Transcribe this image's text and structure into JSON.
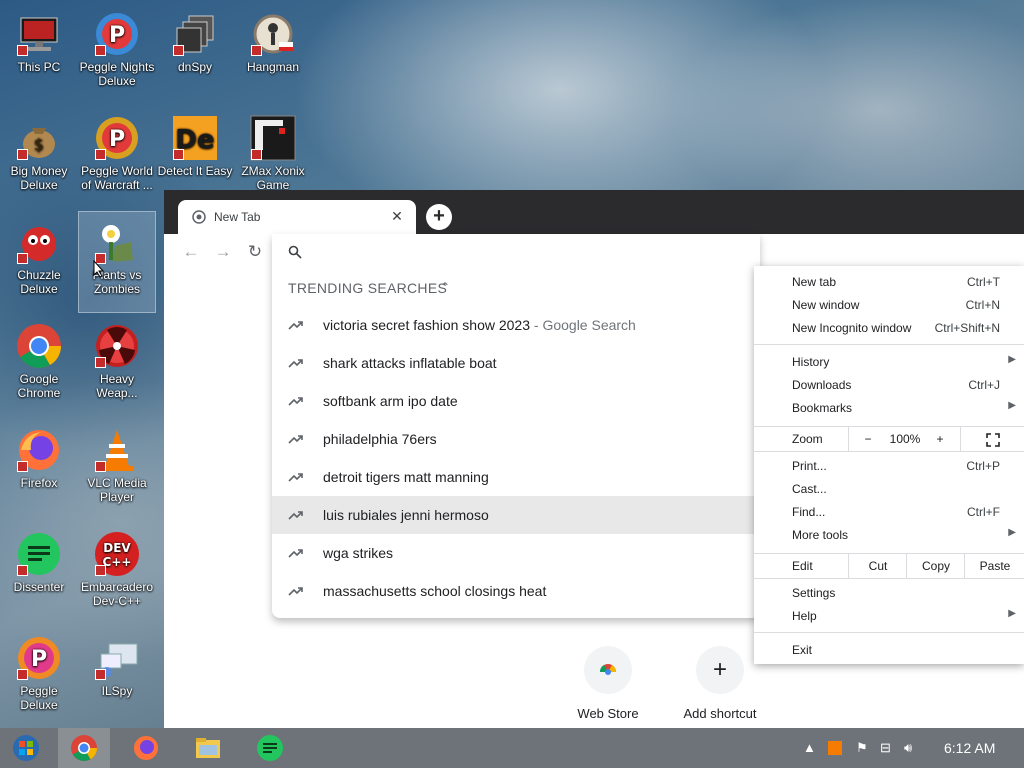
{
  "desktop": {
    "icons": [
      {
        "label": "This PC",
        "icon": "computer-icon"
      },
      {
        "label": "Peggle Nights Deluxe",
        "icon": "peggle-icon"
      },
      {
        "label": "dnSpy",
        "icon": "dnspy-icon"
      },
      {
        "label": "Hangman",
        "icon": "hangman-icon"
      },
      {
        "label": "Big Money Deluxe",
        "icon": "money-bag-icon"
      },
      {
        "label": "Peggle World of Warcraft ...",
        "icon": "peggle-icon"
      },
      {
        "label": "Detect It Easy",
        "icon": "die-icon"
      },
      {
        "label": "ZMax Xonix Game",
        "icon": "xonix-icon"
      },
      {
        "label": "Chuzzle Deluxe",
        "icon": "chuzzle-icon"
      },
      {
        "label": "Plants vs Zombies",
        "icon": "pvz-icon"
      },
      {
        "label": "Google Chrome",
        "icon": "chrome-icon"
      },
      {
        "label": "Heavy Weap...",
        "icon": "radiation-icon"
      },
      {
        "label": "Firefox",
        "icon": "firefox-icon"
      },
      {
        "label": "VLC Media Player",
        "icon": "vlc-cone-icon"
      },
      {
        "label": "Dissenter",
        "icon": "dissenter-icon"
      },
      {
        "label": "Embarcadero Dev-C++",
        "icon": "devcpp-icon"
      },
      {
        "label": "Peggle Deluxe",
        "icon": "peggle-icon"
      },
      {
        "label": "ILSpy",
        "icon": "ilspy-icon"
      }
    ]
  },
  "browser": {
    "tab_title": "New Tab",
    "new_tab_symbol": "+",
    "omnibox": {
      "placeholder": "",
      "trending_header": "TRENDING SEARCHES",
      "suggestions": [
        {
          "text": "victoria secret fashion show 2023",
          "sub": " - Google Search"
        },
        {
          "text": "shark attacks inflatable boat",
          "sub": ""
        },
        {
          "text": "softbank arm ipo date",
          "sub": ""
        },
        {
          "text": "philadelphia 76ers",
          "sub": ""
        },
        {
          "text": "detroit tigers matt manning",
          "sub": ""
        },
        {
          "text": "luis rubiales jenni hermoso",
          "sub": ""
        },
        {
          "text": "wga strikes",
          "sub": ""
        },
        {
          "text": "massachusetts school closings heat",
          "sub": ""
        }
      ],
      "highlighted_index": 5
    },
    "shortcuts": [
      {
        "label": "Web Store",
        "icon": "web-store-icon"
      },
      {
        "label": "Add shortcut",
        "icon": "plus-icon"
      }
    ]
  },
  "menu": {
    "new_tab": {
      "label": "New tab",
      "key": "Ctrl+T"
    },
    "new_window": {
      "label": "New window",
      "key": "Ctrl+N"
    },
    "incognito": {
      "label": "New Incognito window",
      "key": "Ctrl+Shift+N"
    },
    "history": {
      "label": "History"
    },
    "downloads": {
      "label": "Downloads",
      "key": "Ctrl+J"
    },
    "bookmarks": {
      "label": "Bookmarks"
    },
    "zoom": {
      "label": "Zoom",
      "minus": "−",
      "value": "100%",
      "plus": "+"
    },
    "print": {
      "label": "Print...",
      "key": "Ctrl+P"
    },
    "cast": {
      "label": "Cast..."
    },
    "find": {
      "label": "Find...",
      "key": "Ctrl+F"
    },
    "more_tools": {
      "label": "More tools"
    },
    "edit": {
      "label": "Edit",
      "cut": "Cut",
      "copy": "Copy",
      "paste": "Paste"
    },
    "settings": {
      "label": "Settings"
    },
    "help": {
      "label": "Help"
    },
    "exit": {
      "label": "Exit"
    }
  },
  "taskbar": {
    "pinned": [
      "start-orb-icon",
      "chrome-icon",
      "firefox-icon",
      "file-explorer-icon",
      "dissenter-icon"
    ],
    "clock": "6:12 AM"
  }
}
